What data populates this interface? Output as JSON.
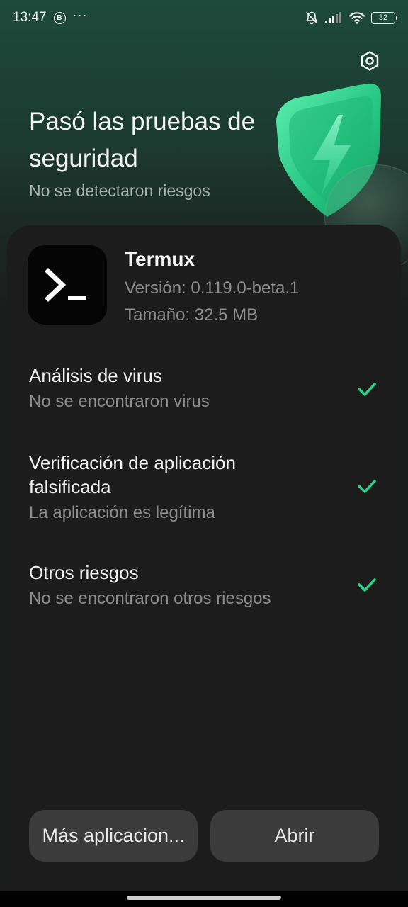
{
  "status_bar": {
    "time": "13:47",
    "b_badge": "B",
    "more": "···",
    "battery": "32",
    "icons": [
      "mute-bell-icon",
      "signal-icon",
      "wifi-icon",
      "battery-icon"
    ]
  },
  "header": {
    "title": "Pasó las pruebas de seguridad",
    "subtitle": "No se detectaron riesgos",
    "settings_icon": "settings-hexagon-icon",
    "illustration": "shield-lightning-icon"
  },
  "app": {
    "name": "Termux",
    "version": "Versión: 0.119.0-beta.1",
    "size": "Tamaño: 32.5 MB",
    "icon": "terminal-icon"
  },
  "checks": [
    {
      "title": "Análisis de virus",
      "desc": "No se encontraron virus",
      "status": "passed"
    },
    {
      "title": "Verificación de aplicación falsificada",
      "desc": "La aplicación es legítima",
      "status": "passed"
    },
    {
      "title": "Otros riesgos",
      "desc": "No se encontraron otros riesgos",
      "status": "passed"
    }
  ],
  "buttons": {
    "more_apps": "Más aplicacion...",
    "open": "Abrir"
  },
  "colors": {
    "accent_green": "#2fd08a",
    "card_bg": "#1c1c1c",
    "button_bg": "#3b3b3b"
  }
}
